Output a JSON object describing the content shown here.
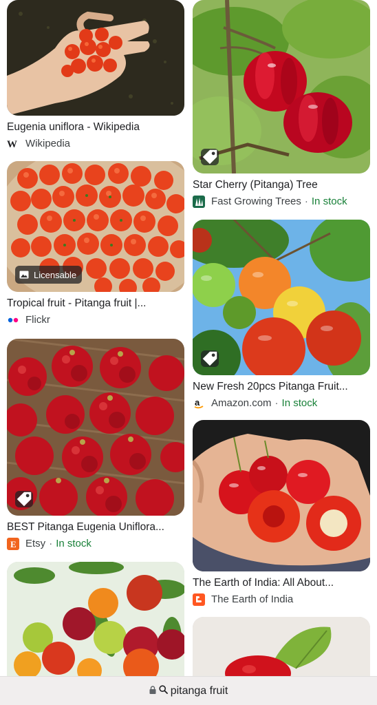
{
  "results": {
    "left": [
      {
        "title": "Eugenia uniflora - Wikipedia",
        "source": "Wikipedia",
        "favicon": "wikipedia-w-icon"
      },
      {
        "title": "Tropical fruit - Pitanga fruit |...",
        "source": "Flickr",
        "badge": "Licensable",
        "favicon": "flickr-dots-icon"
      },
      {
        "title": "BEST Pitanga Eugenia Uniflora...",
        "source": "Etsy",
        "stock": "In stock",
        "favicon": "etsy-e-icon"
      },
      {
        "title": "",
        "source": ""
      }
    ],
    "right": [
      {
        "title": "Star Cherry (Pitanga) Tree",
        "source": "Fast Growing Trees",
        "stock": "In stock",
        "favicon": "tree-icon"
      },
      {
        "title": "New Fresh 20pcs Pitanga Fruit...",
        "source": "Amazon.com",
        "stock": "In stock",
        "favicon": "amazon-a-icon"
      },
      {
        "title": "The Earth of India: All About...",
        "source": "The Earth of India",
        "favicon": "blogger-b-icon"
      },
      {
        "title": "",
        "source": ""
      }
    ]
  },
  "urlbar": {
    "text": "pitanga fruit",
    "lock_icon": "lock-icon",
    "search_icon": "search-icon"
  },
  "colors": {
    "stock_green": "#188038",
    "flickr_blue": "#0063dc",
    "flickr_pink": "#ff0084",
    "etsy_orange": "#f1641e",
    "blogger_orange": "#ff5722",
    "tree_green": "#1b6b4a"
  }
}
